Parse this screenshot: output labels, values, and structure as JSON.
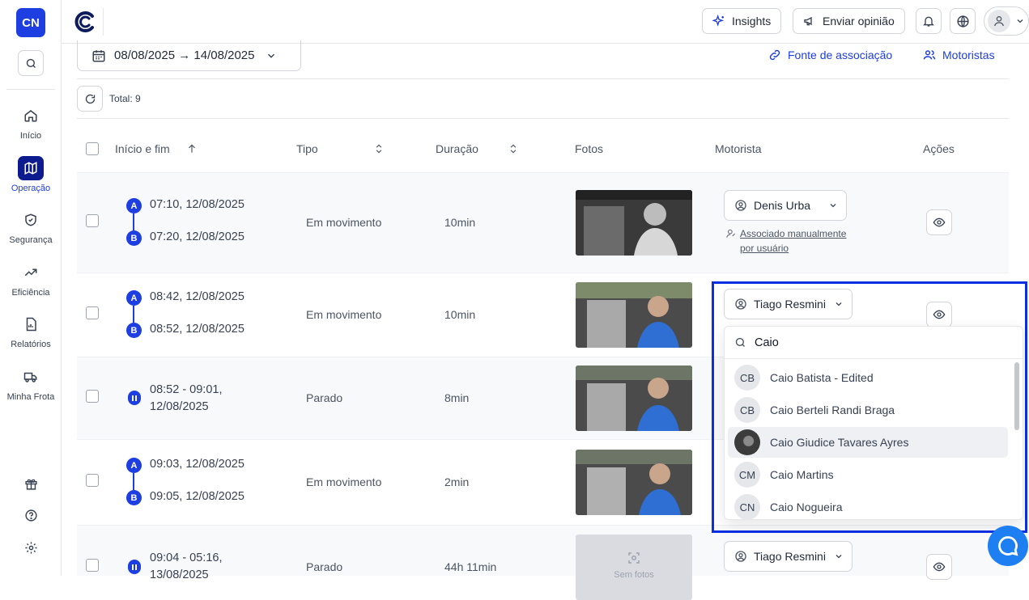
{
  "sidebar": {
    "logo": "CN",
    "items": [
      {
        "label": "Início",
        "icon": "home-icon"
      },
      {
        "label": "Operação",
        "icon": "map-icon",
        "active": true
      },
      {
        "label": "Segurança",
        "icon": "shield-icon"
      },
      {
        "label": "Eficiência",
        "icon": "trend-icon"
      },
      {
        "label": "Relatórios",
        "icon": "report-icon"
      },
      {
        "label": "Minha Frota",
        "icon": "truck-icon"
      }
    ]
  },
  "topbar": {
    "insights_label": "Insights",
    "feedback_label": "Enviar opinião"
  },
  "filters": {
    "date_range": "08/08/2025 → 14/08/2025",
    "association_link": "Fonte de associação",
    "drivers_link": "Motoristas",
    "total": "Total: 9"
  },
  "table": {
    "headers": {
      "start_end": "Início e fim",
      "type": "Tipo",
      "duration": "Duração",
      "photos": "Fotos",
      "driver": "Motorista",
      "actions": "Ações"
    },
    "rows": [
      {
        "start": "07:10, 12/08/2025",
        "end": "07:20, 12/08/2025",
        "type": "Em movimento",
        "duration": "10min",
        "driver": "Denis Urba",
        "assoc_line1": "Associado manualmente",
        "assoc_line2": "por usuário"
      },
      {
        "start": "08:42, 12/08/2025",
        "end": "08:52, 12/08/2025",
        "type": "Em movimento",
        "duration": "10min",
        "driver": "Tiago Resmini"
      },
      {
        "range_line1": "08:52 - 09:01,",
        "range_line2": "12/08/2025",
        "type": "Parado",
        "duration": "8min"
      },
      {
        "start": "09:03, 12/08/2025",
        "end": "09:05, 12/08/2025",
        "type": "Em movimento",
        "duration": "2min"
      },
      {
        "range_line1": "09:04 - 05:16,",
        "range_line2": "13/08/2025",
        "type": "Parado",
        "duration": "44h 11min",
        "driver": "Tiago Resmini",
        "no_photos": "Sem fotos"
      }
    ]
  },
  "dropdown": {
    "search_value": "Caio",
    "options": [
      {
        "initials": "CB",
        "name": "Caio Batista - Edited"
      },
      {
        "initials": "CB",
        "name": "Caio Berteli Randi Braga"
      },
      {
        "initials": "",
        "name": "Caio Giudice Tavares Ayres",
        "highlighted": true
      },
      {
        "initials": "CM",
        "name": "Caio Martins"
      },
      {
        "initials": "CN",
        "name": "Caio Nogueira"
      }
    ]
  },
  "colors": {
    "accent": "#1d3ee0",
    "nav_active": "#0d1b8f",
    "highlight_border": "#0a2fe0",
    "chat": "#1d7ff2"
  }
}
